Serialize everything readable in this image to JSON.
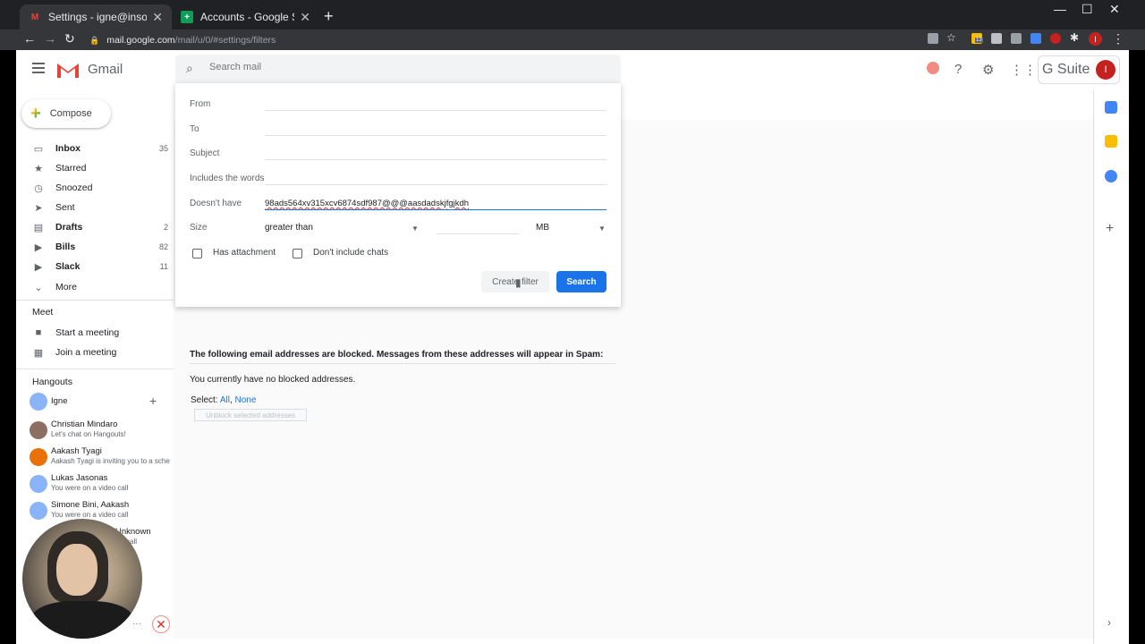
{
  "browser": {
    "tabs": [
      {
        "title": "Settings - igne@insoftia.com",
        "active": true
      },
      {
        "title": "Accounts - Google Sheets",
        "active": false
      }
    ],
    "url_host": "mail.google.com",
    "url_path": "/mail/u/0/#settings/filters",
    "profile_initial": "I",
    "ext_badge": "13"
  },
  "gmail": {
    "brand": "Gmail",
    "search_placeholder": "Search mail",
    "gsuite_label": "G Suite",
    "avatar_initial": "I",
    "compose_label": "Compose",
    "nav": [
      {
        "label": "Inbox",
        "count": "35",
        "icon": "inbox-icon",
        "bold": true
      },
      {
        "label": "Starred",
        "count": "",
        "icon": "star-icon",
        "bold": false
      },
      {
        "label": "Snoozed",
        "count": "",
        "icon": "clock-icon",
        "bold": false
      },
      {
        "label": "Sent",
        "count": "",
        "icon": "send-icon",
        "bold": false
      },
      {
        "label": "Drafts",
        "count": "2",
        "icon": "draft-icon",
        "bold": true
      },
      {
        "label": "Bills",
        "count": "82",
        "icon": "label-icon",
        "bold": true
      },
      {
        "label": "Slack",
        "count": "11",
        "icon": "label-icon",
        "bold": true
      },
      {
        "label": "More",
        "count": "",
        "icon": "chevron-down-icon",
        "bold": false
      }
    ],
    "meet": {
      "title": "Meet",
      "items": [
        {
          "label": "Start a meeting",
          "icon": "video-icon"
        },
        {
          "label": "Join a meeting",
          "icon": "keyboard-icon"
        }
      ]
    },
    "hangouts": {
      "title": "Hangouts",
      "self_name": "Igne",
      "contacts": [
        {
          "name": "Christian Mindaro",
          "status": "Let's chat on Hangouts!"
        },
        {
          "name": "Aakash Tyagi",
          "status": "Aakash Tyagi is inviting you to a sche"
        },
        {
          "name": "Lukas Jasonas",
          "status": "You were on a video call"
        },
        {
          "name": "Simone Bini, Aakash",
          "status": "You were on a video call"
        },
        {
          "name": "Unknown",
          "status": "call"
        }
      ]
    }
  },
  "filter": {
    "from_label": "From",
    "to_label": "To",
    "subject_label": "Subject",
    "includes_label": "Includes the words",
    "doesnt_have_label": "Doesn't have",
    "doesnt_have_value": "98ads564xv315xcv6874sdf987@@@aasdadskjfgjkdh",
    "size_label": "Size",
    "size_operator": "greater than",
    "size_unit": "MB",
    "has_attachment_label": "Has attachment",
    "no_chats_label": "Don't include chats",
    "create_filter_label": "Create filter",
    "search_label": "Search"
  },
  "blocked": {
    "title": "The following email addresses are blocked. Messages from these addresses will appear in Spam:",
    "empty_text": "You currently have no blocked addresses.",
    "select_prefix": "Select:",
    "select_all": "All",
    "select_none": "None",
    "unblock_label": "Unblock selected addresses"
  }
}
